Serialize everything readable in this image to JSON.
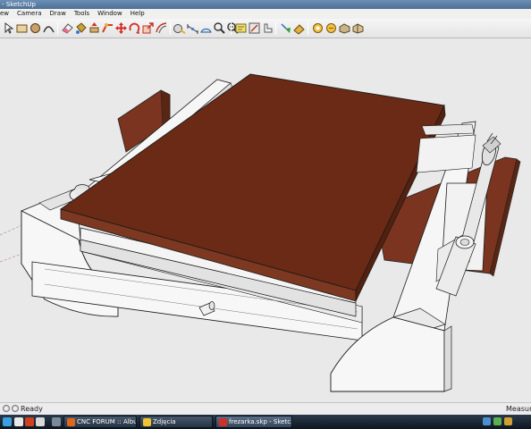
{
  "window": {
    "title": "- SketchUp"
  },
  "menu": [
    "ew",
    "Camera",
    "Draw",
    "Tools",
    "Window",
    "Help"
  ],
  "toolbar": {
    "icons": [
      "select-icon",
      "rectangle-icon",
      "circle-icon",
      "arc-icon",
      "eraser-icon",
      "paint-bucket-icon",
      "push-pull-icon",
      "follow-me-icon",
      "move-icon",
      "rotate-icon",
      "scale-icon",
      "offset-icon",
      "tape-measure-icon",
      "dimension-icon",
      "protractor-icon",
      "text-icon",
      "axes-icon",
      "3d-text-icon",
      "orbit-icon",
      "pan-icon",
      "zoom-icon",
      "zoom-extents-icon",
      "section-plane-icon",
      "walkthrough-icon",
      "look-around-icon",
      "position-camera-icon",
      "warehouse-icon",
      "share-model-icon",
      "components-icon",
      "extension-icon"
    ]
  },
  "status": {
    "text": "Ready",
    "measure_label": "Measure"
  },
  "taskbar": {
    "tasks": [
      {
        "label": "CNC FORUM :: Albu...",
        "icon_color": "#e0661c"
      },
      {
        "label": "Zdjęcia",
        "icon_color": "#f0c430"
      },
      {
        "label": "frezarka.skp - Sketc...",
        "icon_color": "#d0302a",
        "active": true
      }
    ]
  },
  "colors": {
    "viewport_bg": "#e9e9e9",
    "table_top": "#6b2a16",
    "table_top_front": "#7c3820",
    "rail_white": "#f6f6f6",
    "edge": "#1a1a1a"
  }
}
